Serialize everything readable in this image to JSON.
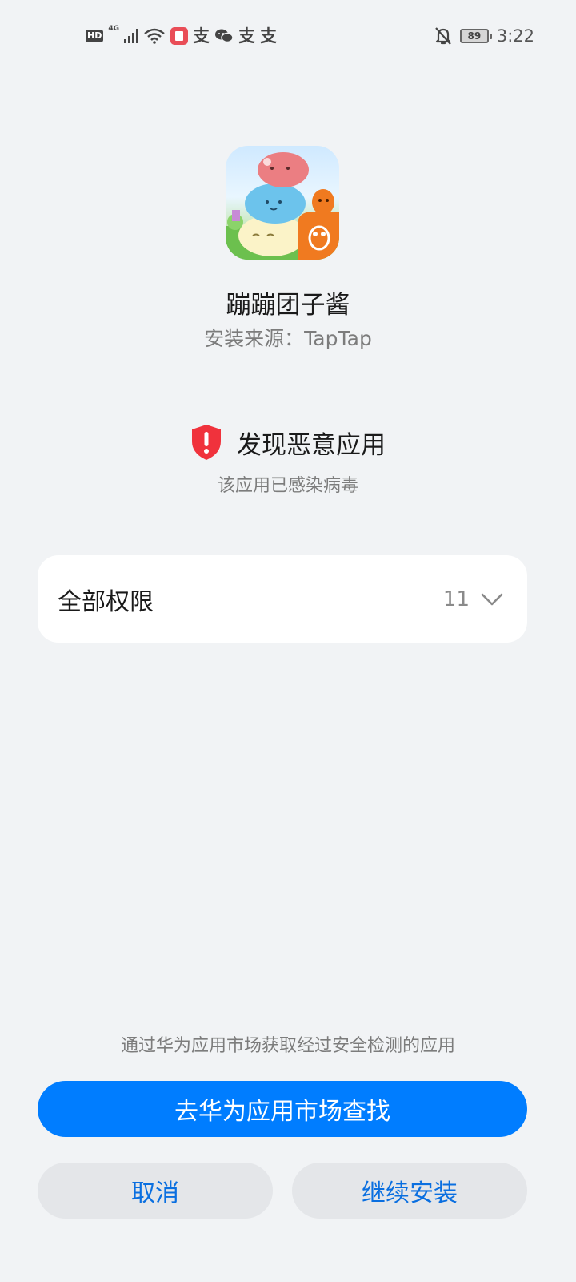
{
  "status_bar": {
    "hd_label": "HD",
    "network_label": "4G",
    "battery_level": "89",
    "time": "3:22",
    "notification_glyph": "支"
  },
  "app": {
    "name": "蹦蹦团子酱",
    "install_source": "安装来源：TapTap",
    "icon": "app-icon-game"
  },
  "warning": {
    "title": "发现恶意应用",
    "subtitle": "该应用已感染病毒",
    "icon": "shield-alert-icon",
    "color": "#f0323c"
  },
  "permissions": {
    "label": "全部权限",
    "count": "11",
    "icon": "chevron-down-icon"
  },
  "footer": {
    "hint": "通过华为应用市场获取经过安全检测的应用",
    "primary_label": "去华为应用市场查找",
    "cancel_label": "取消",
    "continue_label": "继续安装"
  },
  "colors": {
    "background": "#f1f3f5",
    "accent": "#007dff",
    "secondary_button_bg": "#e4e6e9",
    "secondary_button_text": "#0a6fe0"
  }
}
